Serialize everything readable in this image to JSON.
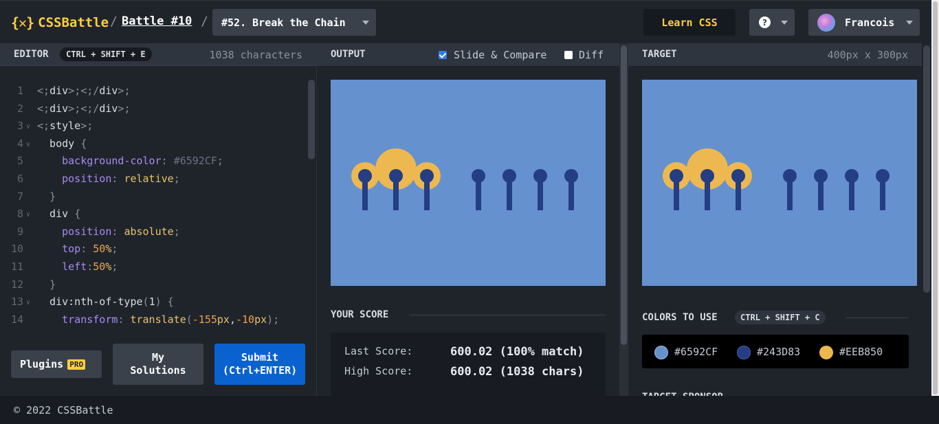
{
  "header": {
    "logo_mark": "{✕}",
    "logo_text": "CSSBattle",
    "separator": "/",
    "battle": "Battle #10",
    "level": "#52. Break the Chain",
    "learn_css": "Learn CSS",
    "help": "?",
    "user": "Francois"
  },
  "editor": {
    "title": "EDITOR",
    "shortcut": "CTRL + SHIFT + E",
    "char_count": "1038 characters",
    "lines": [
      {
        "n": "1",
        "text": "<div></div>"
      },
      {
        "n": "2",
        "text": "<div></div>"
      },
      {
        "n": "3",
        "text": "<style>"
      },
      {
        "n": "4",
        "text": "  body {"
      },
      {
        "n": "5",
        "text": "    background-color: #6592CF;"
      },
      {
        "n": "6",
        "text": "    position: relative;"
      },
      {
        "n": "7",
        "text": "  }"
      },
      {
        "n": "8",
        "text": "  div {"
      },
      {
        "n": "9",
        "text": "    position: absolute;"
      },
      {
        "n": "10",
        "text": "    top: 50%;"
      },
      {
        "n": "11",
        "text": "    left:50%;"
      },
      {
        "n": "12",
        "text": "  }"
      },
      {
        "n": "13",
        "text": "  div:nth-of-type(1) {"
      },
      {
        "n": "14",
        "text": "    transform: translate(-155px,-10px);"
      }
    ],
    "plugins_label": "Plugins",
    "pro_badge": "PRO",
    "my_solutions_line1": "My",
    "my_solutions_line2": "Solutions",
    "submit_line1": "Submit",
    "submit_line2": "(Ctrl+ENTER)"
  },
  "output": {
    "title": "OUTPUT",
    "slide_compare": "Slide & Compare",
    "slide_compare_checked": true,
    "diff": "Diff",
    "diff_checked": false
  },
  "score": {
    "title": "YOUR SCORE",
    "last_label": "Last Score:",
    "last_value": "600.02 (100% match)",
    "high_label": "High Score:",
    "high_value": "600.02 (1038 chars)"
  },
  "target": {
    "title": "TARGET",
    "size": "400px x 300px",
    "colors_title": "COLORS TO USE",
    "colors_shortcut": "CTRL + SHIFT + C",
    "colors": [
      {
        "hex": "#6592CF",
        "label": "#6592CF"
      },
      {
        "hex": "#243D83",
        "label": "#243D83"
      },
      {
        "hex": "#EEB850",
        "label": "#EEB850"
      }
    ],
    "sponsor": "TARGET SPONSOR"
  },
  "footer": {
    "copyright": "© 2022 CSSBattle"
  },
  "theme": {
    "accent_yellow": "#ffcf3d",
    "submit_blue": "#0a62d0",
    "bg": "#1f242b"
  }
}
